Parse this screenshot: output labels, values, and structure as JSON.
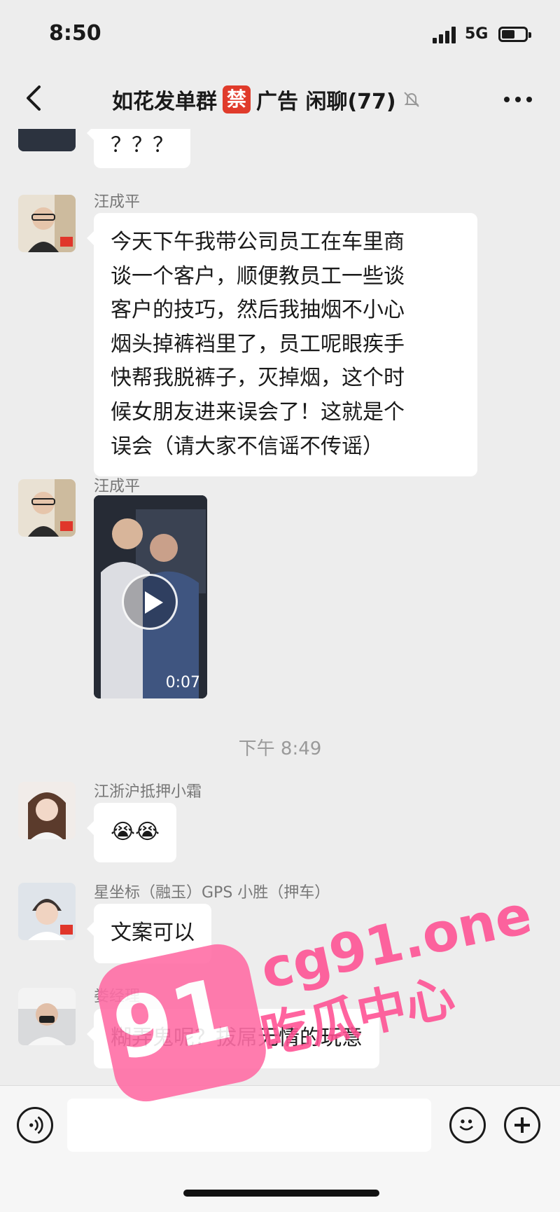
{
  "status_bar": {
    "time": "8:50",
    "network": "5G"
  },
  "header": {
    "title": "如花发单群",
    "ban_badge": "禁",
    "subtitle": "广告 闲聊(77)"
  },
  "messages": [
    {
      "sender": "",
      "text": "？？？"
    },
    {
      "sender": "汪成平",
      "text": "今天下午我带公司员工在车里商\n谈一个客户，顺便教员工一些谈\n客户的技巧，然后我抽烟不小心\n烟头掉裤裆里了，员工呢眼疾手\n快帮我脱裤子，灭掉烟，这个时\n候女朋友进来误会了！这就是个\n误会（请大家不信谣不传谣）"
    },
    {
      "sender": "汪成平",
      "video_duration": "0:07"
    },
    {
      "timestamp": "下午 8:49"
    },
    {
      "sender": "江浙沪抵押小霜",
      "text": "😭😭"
    },
    {
      "sender": "星坐标（融玉）GPS 小胜（押车）",
      "text": "文案可以"
    },
    {
      "sender": "娄经理",
      "text": "糊弄鬼呢？拔屌无情的玩意"
    }
  ],
  "watermark": {
    "domain": "cg91.one",
    "logo": "91",
    "tag": "吃瓜中心"
  },
  "colors": {
    "background": "#ededed",
    "bubble": "#ffffff",
    "accent": "#ff4f92",
    "badge": "#e03b2b"
  }
}
